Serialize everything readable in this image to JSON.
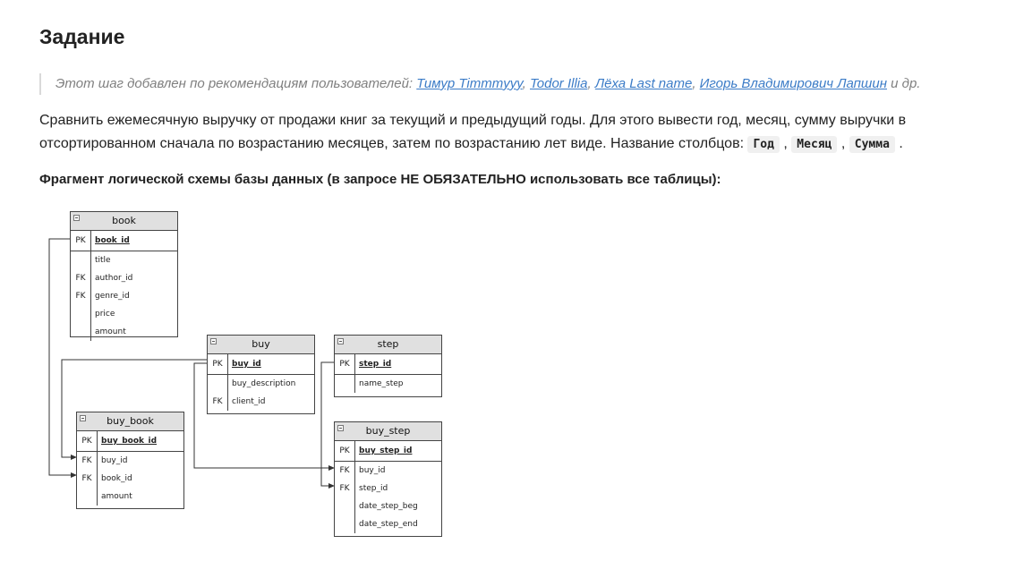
{
  "page": {
    "title": "Задание",
    "note": {
      "prefix": "Этот шаг добавлен по рекомендациям пользователей: ",
      "users": [
        "Тимур Timmmyyy",
        "Todor Illia",
        "Лёха Last name",
        "Игорь Владимирович Лапшин"
      ],
      "separator": ", ",
      "suffix": " и др."
    },
    "description": {
      "text": "Сравнить ежемесячную выручку от продажи книг за текущий и предыдущий годы. Для этого вывести год, месяц, сумму выручки в отсортированном сначала по возрастанию месяцев, затем по возрастанию лет виде. Название столбцов: ",
      "columns": [
        "Год",
        "Месяц",
        "Сумма"
      ],
      "column_separator": " , ",
      "end": " ."
    },
    "schema_heading": "Фрагмент логической схемы базы данных (в запросе НЕ ОБЯЗАТЕЛЬНО использовать все таблицы):"
  },
  "diagram": {
    "tables": [
      {
        "id": "book",
        "name": "book",
        "pk": "book_id",
        "fields": [
          {
            "key": "",
            "name": "title"
          },
          {
            "key": "FK",
            "name": "author_id"
          },
          {
            "key": "FK",
            "name": "genre_id"
          },
          {
            "key": "",
            "name": "price"
          },
          {
            "key": "",
            "name": "amount"
          }
        ]
      },
      {
        "id": "buy",
        "name": "buy",
        "pk": "buy_id",
        "fields": [
          {
            "key": "",
            "name": "buy_description"
          },
          {
            "key": "FK",
            "name": "client_id"
          }
        ]
      },
      {
        "id": "step",
        "name": "step",
        "pk": "step_id",
        "fields": [
          {
            "key": "",
            "name": "name_step"
          }
        ]
      },
      {
        "id": "buy_book",
        "name": "buy_book",
        "pk": "buy_book_id",
        "fields": [
          {
            "key": "FK",
            "name": "buy_id"
          },
          {
            "key": "FK",
            "name": "book_id"
          },
          {
            "key": "",
            "name": "amount"
          }
        ]
      },
      {
        "id": "buy_step",
        "name": "buy_step",
        "pk": "buy_step_id",
        "fields": [
          {
            "key": "FK",
            "name": "buy_id"
          },
          {
            "key": "FK",
            "name": "step_id"
          },
          {
            "key": "",
            "name": "date_step_beg"
          },
          {
            "key": "",
            "name": "date_step_end"
          }
        ]
      }
    ],
    "pk_label": "PK"
  }
}
